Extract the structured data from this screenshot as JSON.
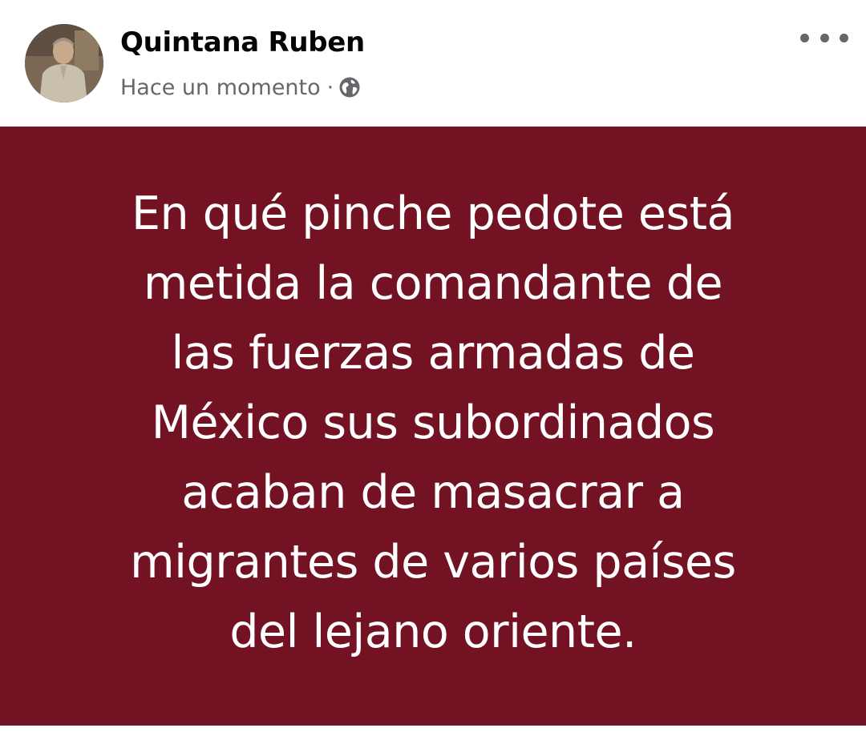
{
  "post": {
    "author": {
      "name": "Quintana Ruben"
    },
    "meta": {
      "time": "Hace un momento",
      "separator": "·",
      "audience_icon": "globe-icon"
    },
    "menu_icon": "more-horizontal-icon",
    "background_color": "#721223",
    "text_color": "#ffffff",
    "text_lines": [
      "En qué pinche pedote está",
      "metida la comandante de",
      "las fuerzas armadas de",
      "México sus subordinados",
      "acaban de masacrar a",
      "migrantes de varios países",
      "del lejano oriente."
    ]
  }
}
